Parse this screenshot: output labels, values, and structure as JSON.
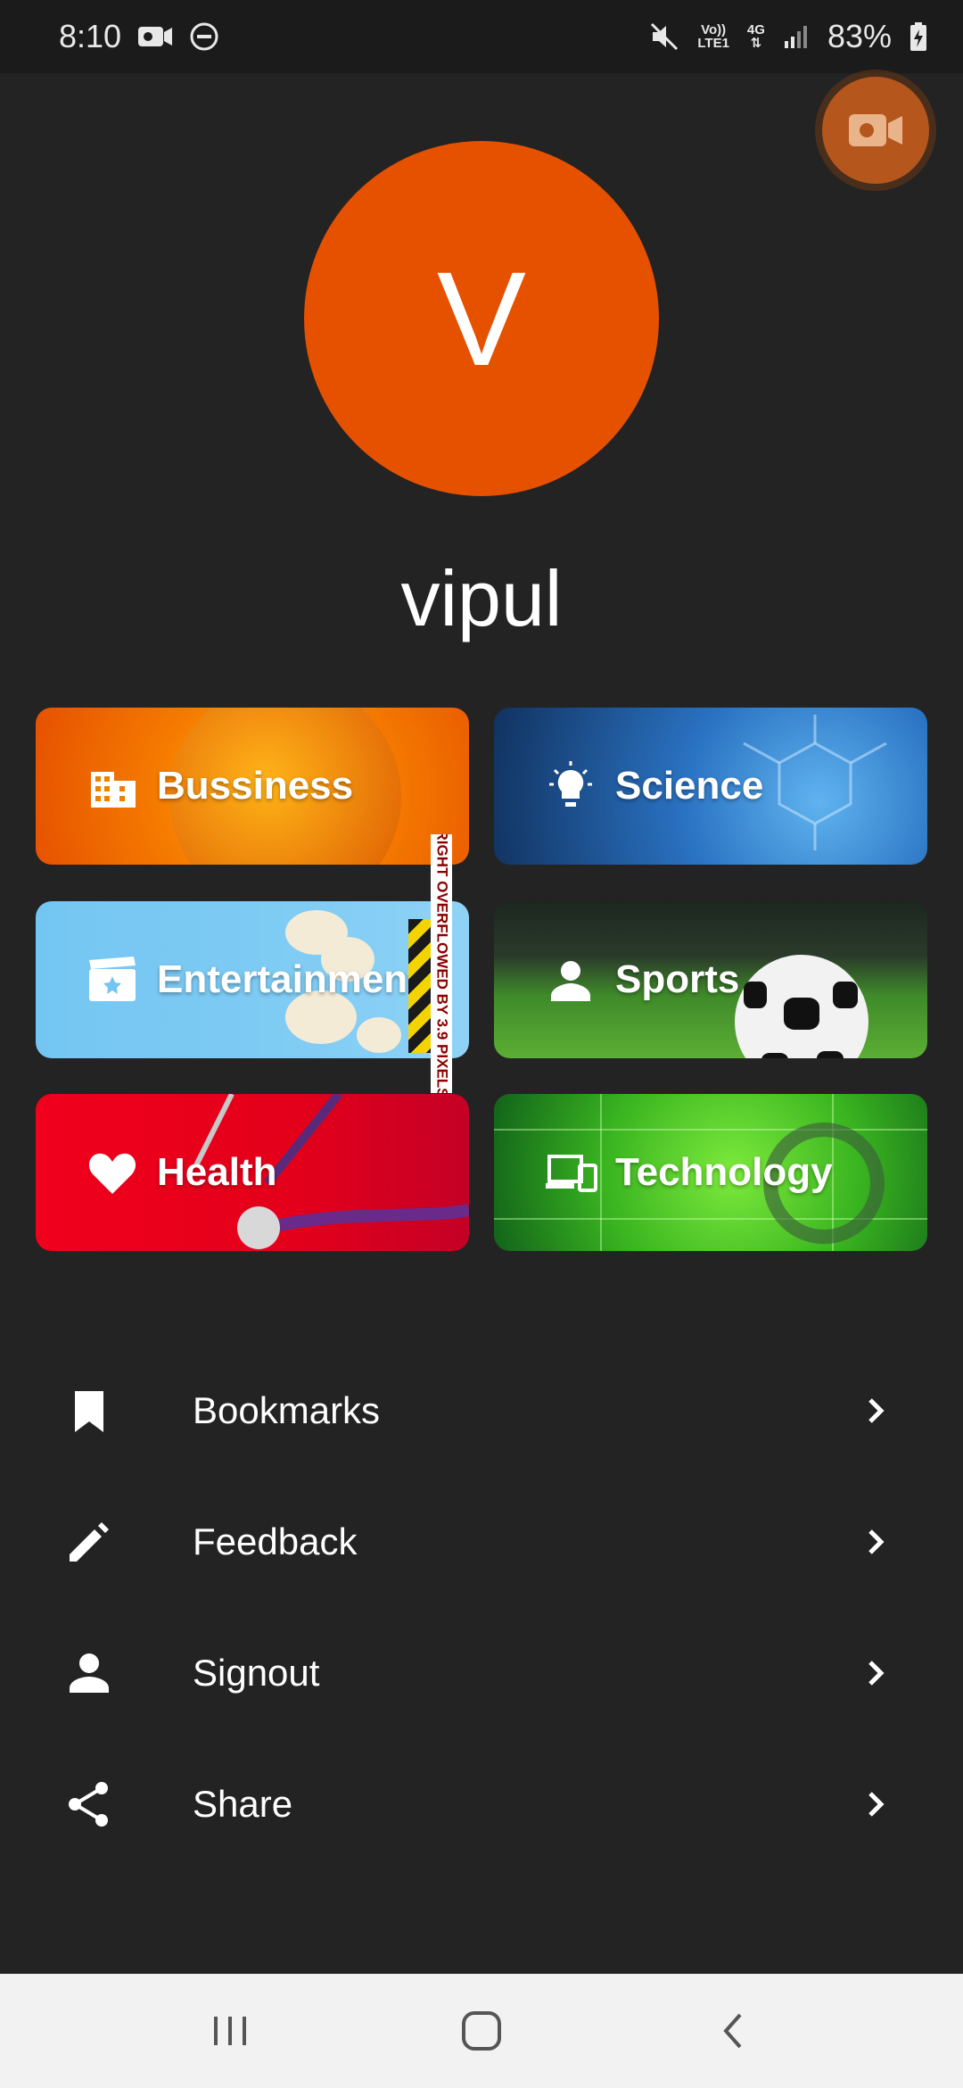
{
  "status_bar": {
    "time": "8:10",
    "network_top": "Vo))",
    "network_bottom": "LTE1",
    "network_type": "4G",
    "battery": "83%"
  },
  "profile": {
    "initial": "V",
    "name": "vipul",
    "avatar_color": "#e65100"
  },
  "categories": [
    {
      "label": "Bussiness",
      "icon": "business-icon"
    },
    {
      "label": "Science",
      "icon": "lightbulb-icon"
    },
    {
      "label": "Entertainment",
      "icon": "movie-icon"
    },
    {
      "label": "Sports",
      "icon": "person-icon"
    },
    {
      "label": "Health",
      "icon": "heart-icon"
    },
    {
      "label": "Technology",
      "icon": "devices-icon"
    }
  ],
  "debug_overflow": "RIGHT OVERFLOWED BY 3.9 PIXELS",
  "menu": [
    {
      "label": "Bookmarks",
      "icon": "bookmark-icon"
    },
    {
      "label": "Feedback",
      "icon": "pencil-icon"
    },
    {
      "label": "Signout",
      "icon": "person-icon"
    },
    {
      "label": "Share",
      "icon": "share-icon"
    }
  ],
  "colors": {
    "background": "#232323",
    "accent": "#e65100"
  }
}
